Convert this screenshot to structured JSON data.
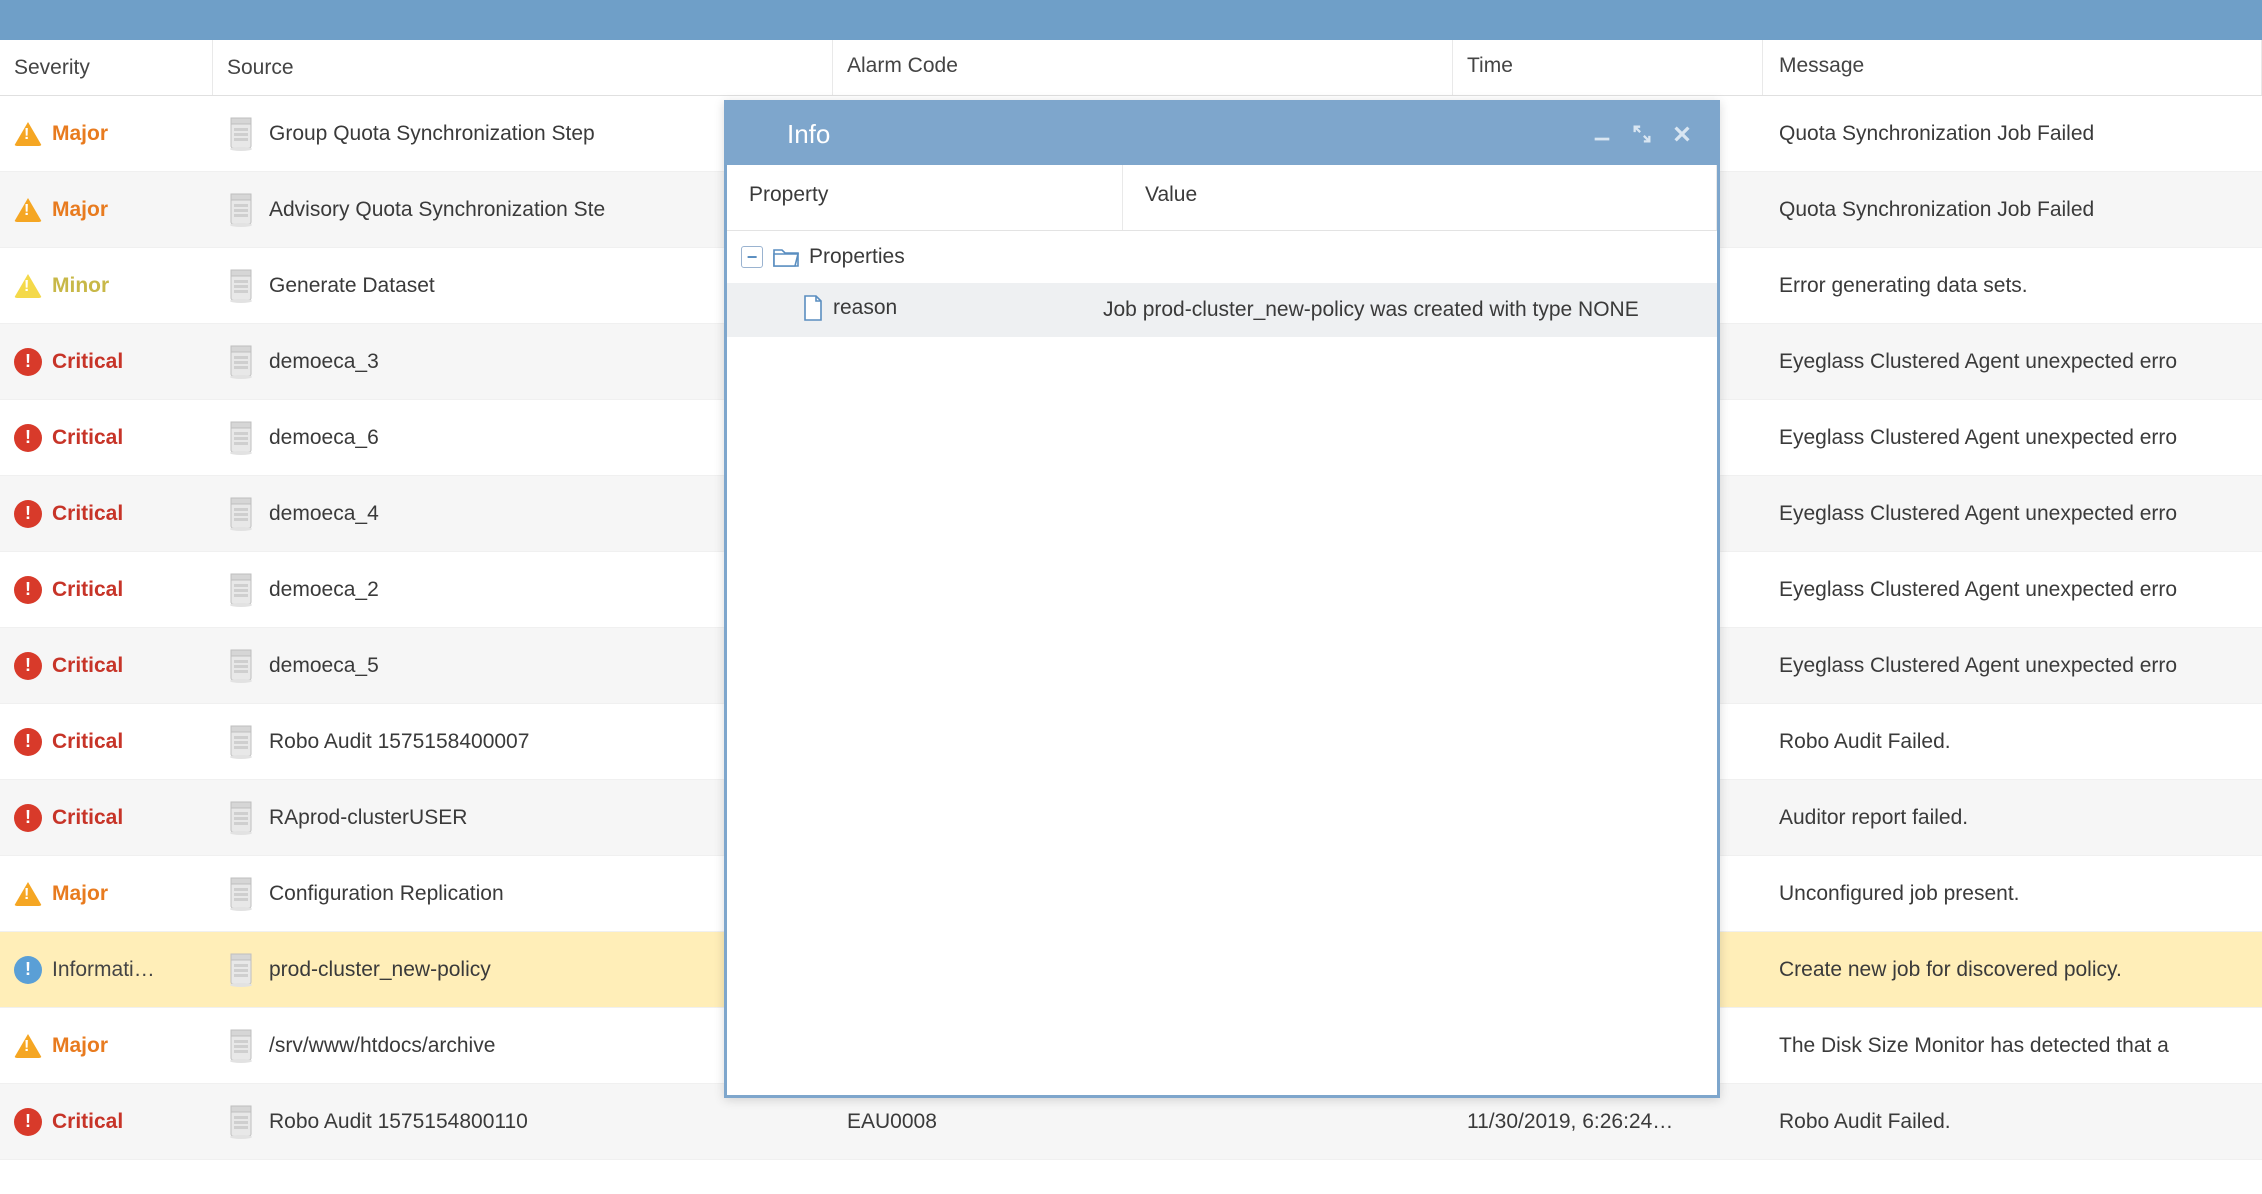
{
  "columns": {
    "severity": "Severity",
    "source": "Source",
    "alarm_code": "Alarm Code",
    "time": "Time",
    "message": "Message"
  },
  "rows": [
    {
      "severity": "Major",
      "sev_class": "major",
      "sev_icon": "tri-orange",
      "source": "Group Quota Synchronization Step",
      "alarm_code": "",
      "time": "",
      "message": "Quota Synchronization Job Failed",
      "alt": false
    },
    {
      "severity": "Major",
      "sev_class": "major",
      "sev_icon": "tri-orange",
      "source": "Advisory Quota Synchronization Ste",
      "alarm_code": "",
      "time": "",
      "message": "Quota Synchronization Job Failed",
      "alt": true
    },
    {
      "severity": "Minor",
      "sev_class": "minor",
      "sev_icon": "tri-yellow",
      "source": "Generate Dataset",
      "alarm_code": "",
      "time": "",
      "message": "Error generating data sets.",
      "alt": false
    },
    {
      "severity": "Critical",
      "sev_class": "critical",
      "sev_icon": "circ-red",
      "source": "demoeca_3",
      "alarm_code": "",
      "time": "",
      "message": "Eyeglass Clustered Agent unexpected erro",
      "alt": true
    },
    {
      "severity": "Critical",
      "sev_class": "critical",
      "sev_icon": "circ-red",
      "source": "demoeca_6",
      "alarm_code": "",
      "time": "",
      "message": "Eyeglass Clustered Agent unexpected erro",
      "alt": false
    },
    {
      "severity": "Critical",
      "sev_class": "critical",
      "sev_icon": "circ-red",
      "source": "demoeca_4",
      "alarm_code": "",
      "time": "",
      "message": "Eyeglass Clustered Agent unexpected erro",
      "alt": true
    },
    {
      "severity": "Critical",
      "sev_class": "critical",
      "sev_icon": "circ-red",
      "source": "demoeca_2",
      "alarm_code": "",
      "time": "",
      "message": "Eyeglass Clustered Agent unexpected erro",
      "alt": false
    },
    {
      "severity": "Critical",
      "sev_class": "critical",
      "sev_icon": "circ-red",
      "source": "demoeca_5",
      "alarm_code": "",
      "time": "",
      "message": "Eyeglass Clustered Agent unexpected erro",
      "alt": true
    },
    {
      "severity": "Critical",
      "sev_class": "critical",
      "sev_icon": "circ-red",
      "source": "Robo Audit 1575158400007",
      "alarm_code": "",
      "time": "",
      "message": "Robo Audit Failed.",
      "alt": false
    },
    {
      "severity": "Critical",
      "sev_class": "critical",
      "sev_icon": "circ-red",
      "source": "RAprod-clusterUSER",
      "alarm_code": "",
      "time": "",
      "message": "Auditor report failed.",
      "alt": true
    },
    {
      "severity": "Major",
      "sev_class": "major",
      "sev_icon": "tri-orange",
      "source": "Configuration Replication",
      "alarm_code": "",
      "time": "",
      "message": "Unconfigured job present.",
      "alt": false
    },
    {
      "severity": "Informati…",
      "sev_class": "info",
      "sev_icon": "circ-blue",
      "source": "prod-cluster_new-policy",
      "alarm_code": "",
      "time": "",
      "message": "Create new job for discovered policy.",
      "alt": false,
      "selected": true
    },
    {
      "severity": "Major",
      "sev_class": "major",
      "sev_icon": "tri-orange",
      "source": "/srv/www/htdocs/archive",
      "alarm_code": "",
      "time": "",
      "message": "The Disk Size Monitor has detected that a",
      "alt": false
    },
    {
      "severity": "Critical",
      "sev_class": "critical",
      "sev_icon": "circ-red",
      "source": "Robo Audit 1575154800110",
      "alarm_code": "EAU0008",
      "time": "11/30/2019, 6:26:24…",
      "message": "Robo Audit Failed.",
      "alt": true
    }
  ],
  "dialog": {
    "title": "Info",
    "col_property": "Property",
    "col_value": "Value",
    "root_label": "Properties",
    "toggle_glyph": "−",
    "item_key": "reason",
    "item_value": "Job prod-cluster_new-policy was created with type NONE"
  }
}
